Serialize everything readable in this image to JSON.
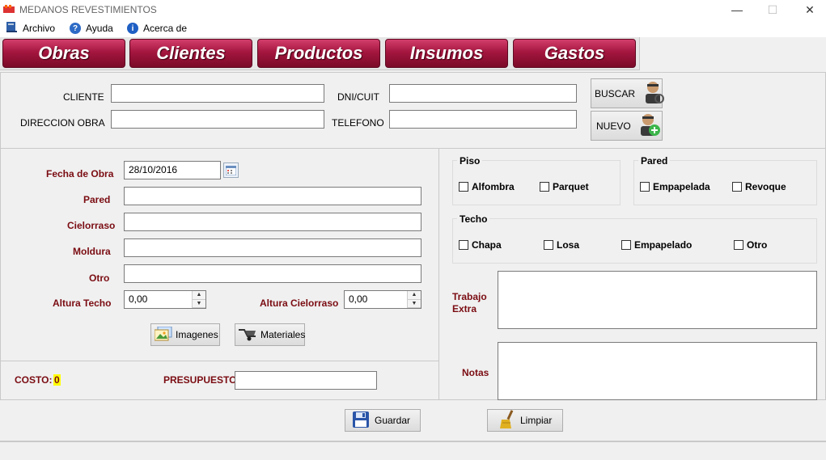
{
  "window": {
    "title": "MEDANOS REVESTIMIENTOS"
  },
  "menu": {
    "archivo": "Archivo",
    "ayuda": "Ayuda",
    "acerca": "Acerca de"
  },
  "tabs": [
    "Obras",
    "Clientes",
    "Productos",
    "Insumos",
    "Gastos"
  ],
  "client": {
    "cliente_label": "CLIENTE",
    "direccion_label": "DIRECCION  OBRA",
    "dni_label": "DNI/CUIT",
    "telefono_label": "TELEFONO",
    "buscar_label": "BUSCAR",
    "nuevo_label": "NUEVO",
    "cliente_value": "",
    "direccion_value": "",
    "dni_value": "",
    "telefono_value": ""
  },
  "obra": {
    "fecha_label": "Fecha de Obra",
    "fecha_value": "28/10/2016",
    "pared_label": "Pared",
    "cielorraso_label": "Cielorraso",
    "moldura_label": "Moldura",
    "otro_label": "Otro",
    "altura_techo_label": "Altura Techo",
    "altura_techo_value": "0,00",
    "altura_cielorraso_label": "Altura Cielorraso",
    "altura_cielorraso_value": "0,00",
    "imagenes_label": "Imagenes",
    "materiales_label": "Materiales"
  },
  "costo": {
    "label": "COSTO:",
    "value": "0",
    "presupuesto_label": "PRESUPUESTO",
    "presupuesto_value": ""
  },
  "piso": {
    "title": "Piso",
    "alfombra": "Alfombra",
    "parquet": "Parquet"
  },
  "pared": {
    "title": "Pared",
    "empapelada": "Empapelada",
    "revoque": "Revoque"
  },
  "techo": {
    "title": "Techo",
    "chapa": "Chapa",
    "losa": "Losa",
    "empapelado": "Empapelado",
    "otro": "Otro"
  },
  "extras": {
    "trabajo_label": "Trabajo Extra",
    "notas_label": "Notas"
  },
  "actions": {
    "guardar": "Guardar",
    "limpiar": "Limpiar"
  },
  "colors": {
    "tab_accent": "#a4163f",
    "label_red": "#7a0c12",
    "costo_highlight": "#ffff00"
  }
}
